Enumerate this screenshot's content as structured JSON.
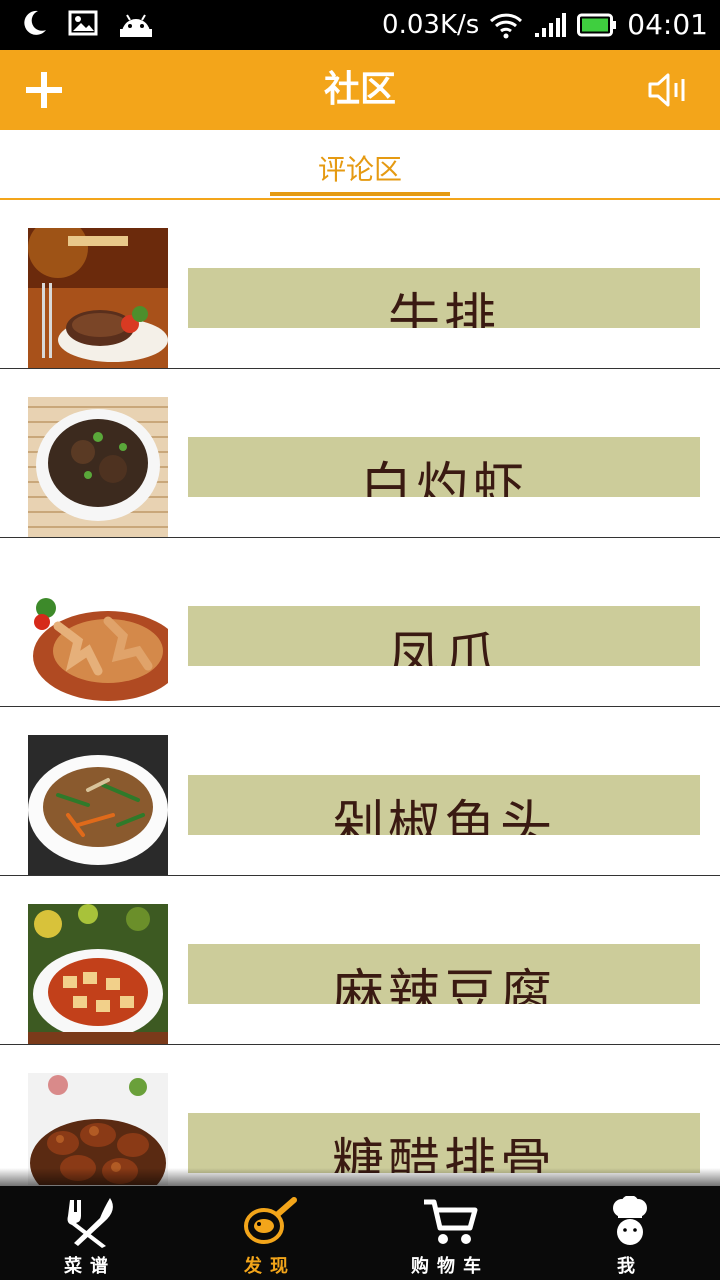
{
  "status_bar": {
    "speed": "0.03K/s",
    "time": "04:01",
    "icons": [
      "moon-icon",
      "image-icon",
      "android-icon",
      "wifi-icon",
      "signal-icon",
      "battery-icon"
    ]
  },
  "app_bar": {
    "title": "社区",
    "left_icon": "plus-icon",
    "right_icon": "speaker-icon"
  },
  "tabs": [
    {
      "label": "评论区",
      "selected": true
    }
  ],
  "dishes": [
    {
      "name": "牛排",
      "image": "steak-photo"
    },
    {
      "name": "白灼虾",
      "image": "braised-dish-photo"
    },
    {
      "name": "凤爪",
      "image": "chicken-feet-photo"
    },
    {
      "name": "剁椒鱼头",
      "image": "stirfry-photo"
    },
    {
      "name": "麻辣豆腐",
      "image": "mapo-tofu-photo"
    },
    {
      "name": "糖醋排骨",
      "image": "sweet-sour-ribs-photo"
    }
  ],
  "bottom_nav": [
    {
      "label": "菜谱",
      "icon": "fork-knife-icon",
      "active": false
    },
    {
      "label": "发现",
      "icon": "discover-pan-icon",
      "active": true
    },
    {
      "label": "购物车",
      "icon": "cart-icon",
      "active": false
    },
    {
      "label": "我",
      "icon": "chef-icon",
      "active": false
    }
  ],
  "colors": {
    "accent": "#f3a51a",
    "band": "#cccc9a",
    "dish_text": "#3a1a12"
  }
}
